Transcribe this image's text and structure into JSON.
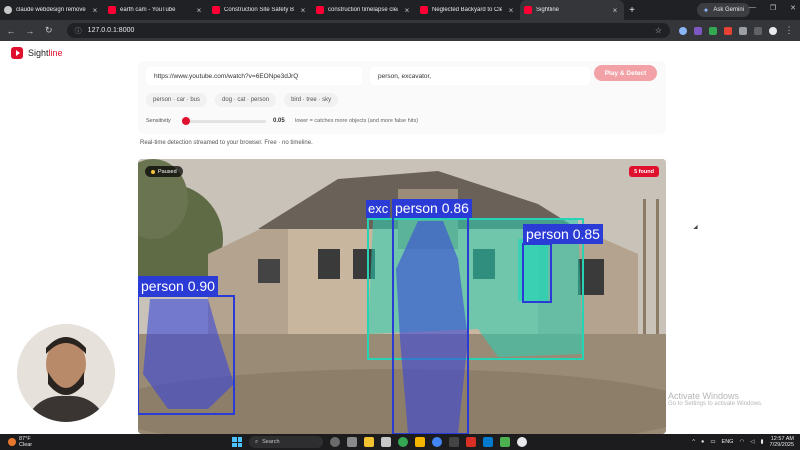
{
  "browser": {
    "tabs": [
      {
        "title": "claude webdesign remove",
        "favicon": "github-icon"
      },
      {
        "title": "earth cam - YouTube",
        "favicon": "youtube-icon"
      },
      {
        "title": "Construction Site Safety Ba",
        "favicon": "youtube-icon"
      },
      {
        "title": "construction timelapse clea",
        "favicon": "youtube-icon"
      },
      {
        "title": "Neglected Backyard to Clea",
        "favicon": "youtube-icon"
      },
      {
        "title": "Sightline",
        "favicon": "sightline-icon",
        "active": true
      }
    ],
    "new_tab": "+",
    "ask_gemini": "Ask Gemini",
    "address": "127.0.0.1:8000"
  },
  "app": {
    "name_prefix": "Sight",
    "name_accent": "line",
    "url_value": "https://www.youtube.com/watch?v=6EONpe3dJrQ",
    "objects_value": "person, excavator,",
    "play_label": "Play & Detect",
    "presets": [
      "person · car · bus",
      "dog · cat · person",
      "bird · tree · sky"
    ],
    "sensitivity_label": "Sensitivity",
    "sensitivity_value": "0.05",
    "sensitivity_fraction": 0.05,
    "sensitivity_hint": "lower = catches more objects (and more false hits)",
    "description": "Real-time detection streamed to your browser. Free · no timeline.",
    "status_badge": "Paused",
    "found_badge": "5 found",
    "detections": [
      {
        "label": "person 0.90",
        "color": "#2b3bd6"
      },
      {
        "label": "exc",
        "color": "#2b3bd6"
      },
      {
        "label": "person 0.86",
        "color": "#2b3bd6"
      },
      {
        "label": "person 0.85",
        "color": "#2b3bd6"
      }
    ],
    "excavator_color": "#27d3b5"
  },
  "watermark": {
    "line1": "Activate Windows",
    "line2": "Go to Settings to activate Windows."
  },
  "taskbar": {
    "temp": "87°F",
    "condition": "Clear",
    "search_placeholder": "Search",
    "lang": "ENG",
    "time": "12:57 AM",
    "date": "7/29/2025"
  }
}
